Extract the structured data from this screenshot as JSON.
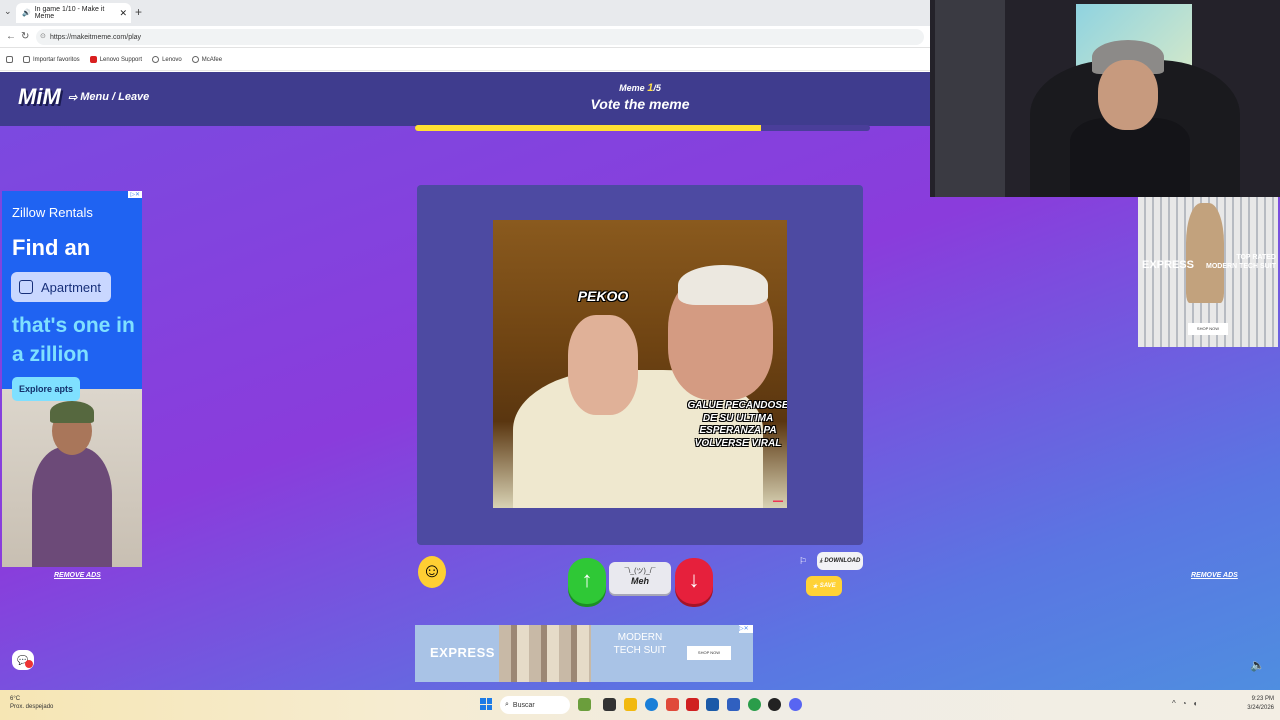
{
  "browser": {
    "tab_title": "In game 1/10 - Make it Meme",
    "tab_close": "✕",
    "new_tab": "+",
    "url": "https://makeitmeme.com/play",
    "bookmarks": [
      "Importar favoritos",
      "Lenovo Support",
      "Lenovo",
      "McAfee"
    ]
  },
  "game": {
    "logo": "MiM",
    "menu_leave": "Menu / Leave",
    "meme_label": "Meme",
    "meme_current": "1",
    "meme_total": "/5",
    "vote_title": "Vote the meme",
    "progress_fraction": 0.76,
    "meme": {
      "top_text": "PEKOO",
      "bottom_text": "GALUE PECANDOSE DE SU ULTIMA ESPERANZA PA VOLVERSE VIRAL"
    },
    "meh_shrug": "¯\\_(ツ)_/¯",
    "meh_label": "Meh",
    "download_label": "DOWNLOAD",
    "save_label": "SAVE",
    "remove_ads": "REMOVE ADS"
  },
  "ad_left": {
    "brand": "Zillow Rentals",
    "headline1": "Find an",
    "pill": "Apartment",
    "headline2": "that's one in a zillion",
    "cta": "Explore apts"
  },
  "ad_bottom": {
    "logo": "EXPRESS",
    "headline": "MODERN TECH SUIT",
    "cta": "SHOP NOW"
  },
  "ad_right": {
    "logo": "EXPRESS",
    "headline": "TOP RATED MODERN TECH SUIT",
    "cta": "SHOP NOW"
  },
  "taskbar": {
    "temp": "6°C",
    "weather": "Prox. despejado",
    "search": "Buscar",
    "time": "9:23 PM",
    "date": "3/24/2026"
  },
  "colors": {
    "vote_up": "#2fc836",
    "vote_down": "#e6203c",
    "progress": "#ffe033",
    "header": "#3f3c8e"
  }
}
